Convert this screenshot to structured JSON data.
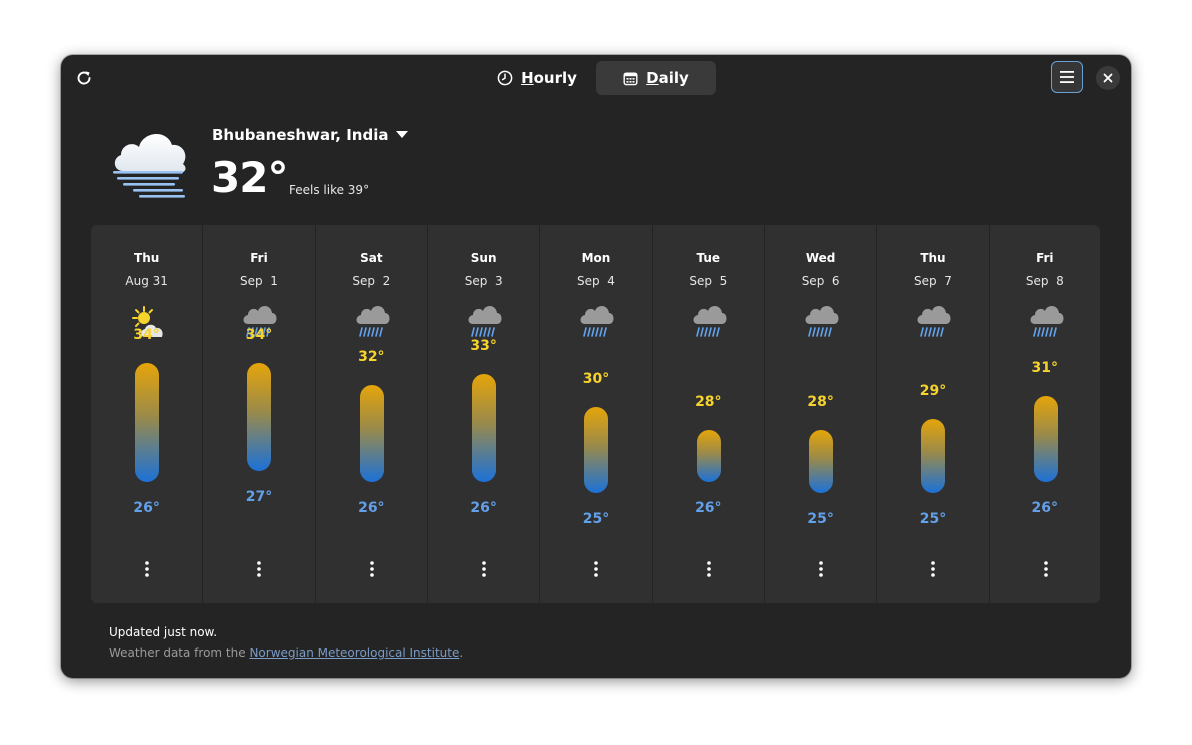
{
  "header": {
    "hourly_label": "Hourly",
    "daily_label": "Daily",
    "active_tab": "Daily"
  },
  "current": {
    "location": "Bhubaneshwar, India",
    "temperature": "32°",
    "feels_like": "Feels like 39°",
    "icon": "fog-cloud-icon"
  },
  "days": [
    {
      "name": "Thu",
      "date": "Aug 31",
      "icon": "partly-cloudy-sun-icon",
      "high": "34°",
      "low": "26°",
      "high_value": 34,
      "low_value": 26
    },
    {
      "name": "Fri",
      "date": "Sep  1",
      "icon": "rain-cloud-icon",
      "high": "34°",
      "low": "27°",
      "high_value": 34,
      "low_value": 27
    },
    {
      "name": "Sat",
      "date": "Sep  2",
      "icon": "rain-cloud-icon",
      "high": "32°",
      "low": "26°",
      "high_value": 32,
      "low_value": 26
    },
    {
      "name": "Sun",
      "date": "Sep  3",
      "icon": "rain-cloud-icon",
      "high": "33°",
      "low": "26°",
      "high_value": 33,
      "low_value": 26
    },
    {
      "name": "Mon",
      "date": "Sep  4",
      "icon": "rain-cloud-icon",
      "high": "30°",
      "low": "25°",
      "high_value": 30,
      "low_value": 25
    },
    {
      "name": "Tue",
      "date": "Sep  5",
      "icon": "rain-cloud-icon",
      "high": "28°",
      "low": "26°",
      "high_value": 28,
      "low_value": 26
    },
    {
      "name": "Wed",
      "date": "Sep  6",
      "icon": "rain-cloud-icon",
      "high": "28°",
      "low": "25°",
      "high_value": 28,
      "low_value": 25
    },
    {
      "name": "Thu",
      "date": "Sep  7",
      "icon": "rain-cloud-icon",
      "high": "29°",
      "low": "25°",
      "high_value": 29,
      "low_value": 25
    },
    {
      "name": "Fri",
      "date": "Sep  8",
      "icon": "rain-cloud-icon",
      "high": "31°",
      "low": "26°",
      "high_value": 31,
      "low_value": 26
    }
  ],
  "footer": {
    "updated": "Updated just now.",
    "source_prefix": "Weather data from the ",
    "source_link": "Norwegian Meteorological Institute",
    "source_suffix": "."
  },
  "colors": {
    "window_bg": "#242424",
    "panel_bg": "#303030",
    "high_temp": "#f6d32d",
    "low_temp": "#62a0ea",
    "accent": "#6aa0d6"
  }
}
